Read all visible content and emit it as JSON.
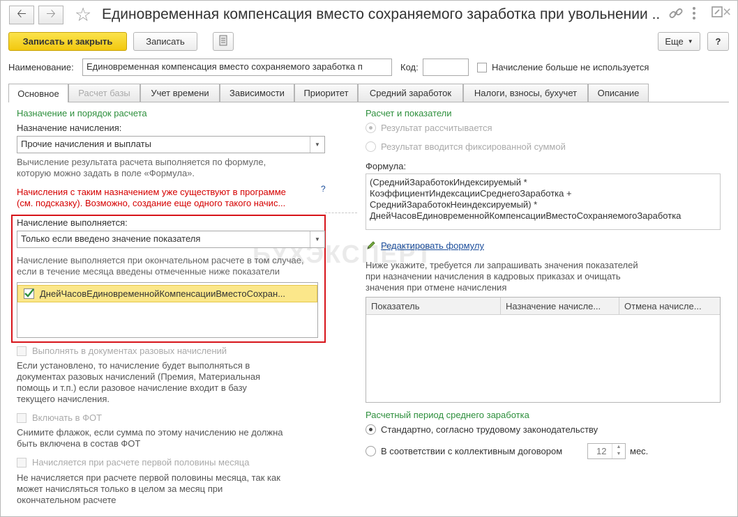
{
  "window": {
    "title": "Единовременная компенсация вместо сохраняемого заработка при увольнении ...",
    "more_label": "Еще",
    "help_label": "?"
  },
  "toolbar": {
    "save_close_label": "Записать и закрыть",
    "save_label": "Записать"
  },
  "header": {
    "name_label": "Наименование:",
    "name_value": "Единовременная компенсация вместо сохраняемого заработка п",
    "code_label": "Код:",
    "code_value": "",
    "obsolete_label": "Начисление больше не используется"
  },
  "tabs": [
    {
      "label": "Основное"
    },
    {
      "label": "Расчет базы"
    },
    {
      "label": "Учет времени"
    },
    {
      "label": "Зависимости"
    },
    {
      "label": "Приоритет"
    },
    {
      "label": "Средний заработок"
    },
    {
      "label": "Налоги, взносы, бухучет"
    },
    {
      "label": "Описание"
    }
  ],
  "left": {
    "section_title": "Назначение и порядок расчета",
    "purpose_label": "Назначение начисления:",
    "purpose_value": "Прочие начисления и выплаты",
    "purpose_hint_1": "Вычисление результата расчета выполняется по формуле,",
    "purpose_hint_2": "которую можно задать в поле «Формула».",
    "warning_1": "Начисления с таким назначением уже существуют в программе",
    "warning_2": "(см. подсказку). Возможно, создание еще одного такого начис...",
    "warning_help": "?",
    "executes_label": "Начисление выполняется:",
    "executes_value": "Только если введено значение показателя",
    "executes_hint_1": "Начисление выполняется при окончательном расчете в том случае,",
    "executes_hint_2": "если в течение месяца введены отмеченные ниже показатели",
    "indicator_item": "ДнейЧасовЕдиновременнойКомпенсацииВместоСохран...",
    "one_time_label": "Выполнять в документах разовых начислений",
    "one_time_hint": [
      "Если установлено, то начисление будет выполняться в",
      "документах разовых начислений (Премия, Материальная",
      "помощь и т.п.) если разовое начисление входит в базу",
      "текущего начисления."
    ],
    "fot_label": "Включать в ФОТ",
    "fot_hint": [
      "Снимите флажок, если сумма по этому начислению не должна",
      "быть включена в состав ФОТ"
    ],
    "half_month_label": "Начисляется при расчете первой половины месяца",
    "half_month_hint": [
      "Не начисляется при расчете первой половины месяца, так как",
      "может начисляться только в целом за месяц при",
      "окончательном расчете"
    ]
  },
  "right": {
    "section_title": "Расчет и показатели",
    "radio_calc": "Результат рассчитывается",
    "radio_fixed": "Результат вводится фиксированной суммой",
    "formula_label": "Формула:",
    "formula_lines": [
      "(СреднийЗаработокИндексируемый *",
      "КоэффициентИндексацииСреднегоЗаработка +",
      "СреднийЗаработокНеиндексируемый) *",
      "ДнейЧасовЕдиновременнойКомпенсацииВместоСохраняемогоЗаработка"
    ],
    "edit_formula_link": "Редактировать формулу",
    "indicators_hint": [
      "Ниже укажите, требуется ли запрашивать значения показателей",
      "при назначении начисления в кадровых приказах и очищать",
      "значения при отмене начисления"
    ],
    "table_columns": [
      "Показатель",
      "Назначение начисле...",
      "Отмена начисле..."
    ],
    "period_title": "Расчетный период среднего заработка",
    "period_standard": "Стандартно, согласно трудовому законодательству",
    "period_collective": "В соответствии с коллективным договором",
    "months_value": "12",
    "months_unit": "мес."
  },
  "watermark": "БУХЭКСПЕРТ",
  "colors": {
    "accent_green": "#2d8f3c",
    "warning_red": "#d50000",
    "highlight_red": "#d7141a",
    "primary_button": "#f2c80f",
    "link_blue": "#1c4e9c"
  }
}
